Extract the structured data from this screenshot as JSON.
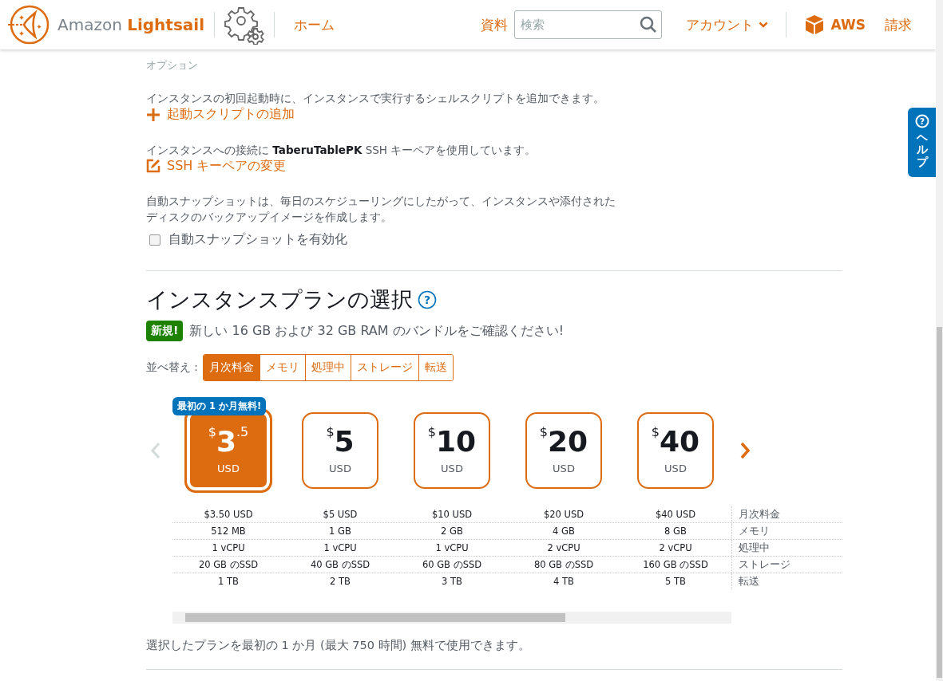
{
  "header": {
    "brand_1": "Amazon",
    "brand_2": "Lightsail",
    "home_link": "ホーム",
    "docs_link": "資料",
    "search": {
      "placeholder": "検索"
    },
    "account_menu": "アカウント",
    "aws_link": "AWS",
    "billing_link": "請求"
  },
  "help_tab": {
    "icon": "?",
    "label": "ヘルプ"
  },
  "options": {
    "heading": "オプション",
    "launch_script": {
      "description": "インスタンスの初回起動時に、インスタンスで実行するシェルスクリプトを追加できます。",
      "action": "起動スクリプトの追加"
    },
    "ssh_key": {
      "description": "インスタンスへの接続に **TaberuTablePK** SSH キーペアを使用しています。",
      "action": "SSH キーペアの変更"
    },
    "snapshot": {
      "description_lines": [
        "自動スナップショットは、毎日のスケジューリングにしたがって、インスタンスや添付された",
        "ディスクのバックアップイメージを作成します。"
      ],
      "checkbox": {
        "label": "自動スナップショットを有効化",
        "checked": false
      }
    }
  },
  "plan_section": {
    "title": "インスタンスプランの選択",
    "help_icon": "?",
    "new_badge": "新規!",
    "new_message": "新しい 16 GB および 32 GB RAM のバンドルをご確認ください!",
    "sort_label": "並べ替え :",
    "sort_options": [
      {
        "label": "月次料金",
        "selected": true
      },
      {
        "label": "メモリ",
        "selected": false
      },
      {
        "label": "処理中",
        "selected": false
      },
      {
        "label": "ストレージ",
        "selected": false
      },
      {
        "label": "転送",
        "selected": false
      }
    ],
    "plans": [
      {
        "currency_symbol": "$",
        "price": "3",
        "price_fraction": ".5",
        "currency": "USD",
        "selected": true,
        "promo_badge": "最初の 1 か月無料!",
        "specs": [
          "$3.50 USD",
          "512 MB",
          "1 vCPU",
          "20 GB のSSD",
          "1 TB"
        ]
      },
      {
        "currency_symbol": "$",
        "price": "5",
        "currency": "USD",
        "selected": false,
        "specs": [
          "$5 USD",
          "1 GB",
          "1 vCPU",
          "40 GB のSSD",
          "2 TB"
        ]
      },
      {
        "currency_symbol": "$",
        "price": "10",
        "currency": "USD",
        "selected": false,
        "specs": [
          "$10 USD",
          "2 GB",
          "1 vCPU",
          "60 GB のSSD",
          "3 TB"
        ]
      },
      {
        "currency_symbol": "$",
        "price": "20",
        "currency": "USD",
        "selected": false,
        "specs": [
          "$20 USD",
          "4 GB",
          "2 vCPU",
          "80 GB のSSD",
          "4 TB"
        ]
      },
      {
        "currency_symbol": "$",
        "price": "40",
        "currency": "USD",
        "selected": false,
        "specs": [
          "$40 USD",
          "8 GB",
          "2 vCPU",
          "160 GB のSSD",
          "5 TB"
        ]
      }
    ],
    "spec_labels": [
      "月次料金",
      "メモリ",
      "処理中",
      "ストレージ",
      "転送"
    ],
    "free_note": "選択したプランを最初の 1 か月 (最大 750 時間) 無料で使用できます。"
  }
}
